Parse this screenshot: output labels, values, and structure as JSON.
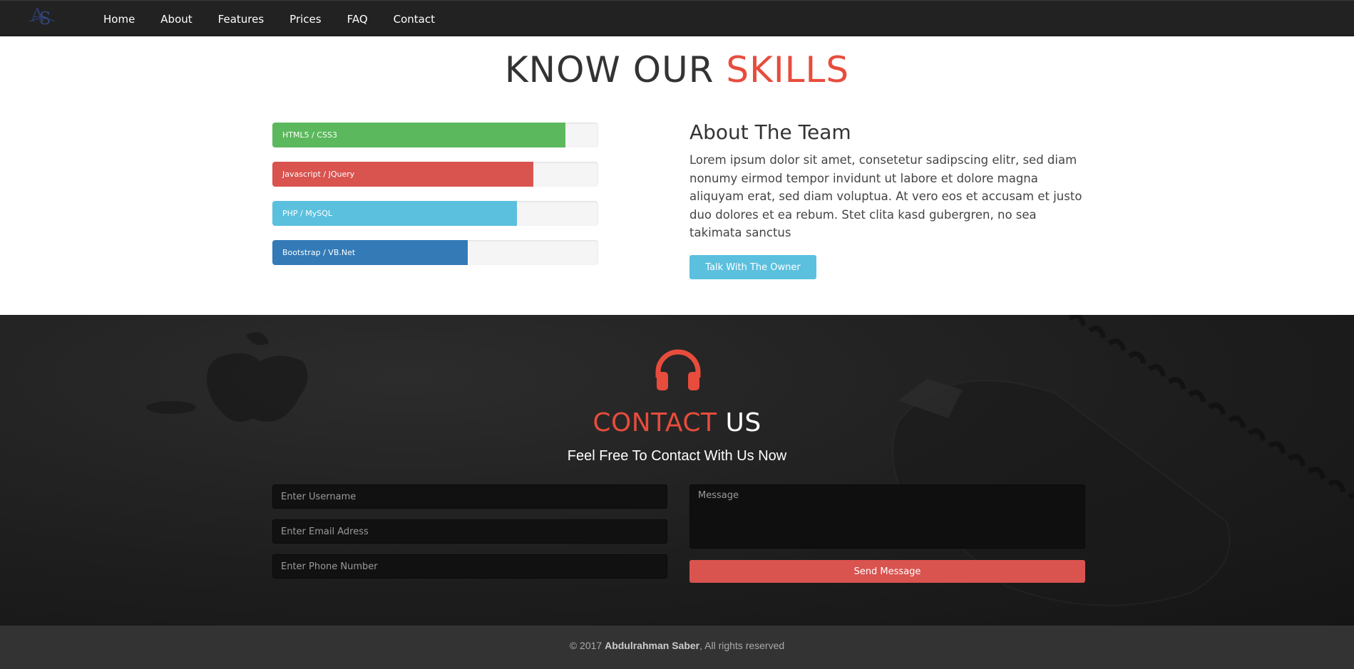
{
  "nav": {
    "items": [
      {
        "label": "Home"
      },
      {
        "label": "About"
      },
      {
        "label": "Features"
      },
      {
        "label": "Prices"
      },
      {
        "label": "FAQ"
      },
      {
        "label": "Contact"
      }
    ]
  },
  "skills": {
    "title_main": "KNOW OUR ",
    "title_accent": "SKILLS",
    "bars": [
      {
        "label": "HTML5 / CSS3",
        "percent": 90,
        "color": "#5cb85c"
      },
      {
        "label": "Javascript / JQuery",
        "percent": 80,
        "color": "#d9534f"
      },
      {
        "label": "PHP / MySQL",
        "percent": 75,
        "color": "#5bc0de"
      },
      {
        "label": "Bootstrap / VB.Net",
        "percent": 60,
        "color": "#337ab7"
      }
    ]
  },
  "team": {
    "title": "About The Team",
    "text": "Lorem ipsum dolor sit amet, consetetur sadipscing elitr, sed diam nonumy eirmod tempor invidunt ut labore et dolore magna aliquyam erat, sed diam voluptua. At vero eos et accusam et justo duo dolores et ea rebum. Stet clita kasd gubergren, no sea takimata sanctus",
    "button_label": "Talk With The Owner"
  },
  "contact": {
    "title_accent": "CONTACT",
    "title_main": " US",
    "subtitle": "Feel Free To Contact With Us Now",
    "username_placeholder": "Enter Username",
    "email_placeholder": "Enter Email Adress",
    "phone_placeholder": "Enter Phone Number",
    "message_placeholder": "Message",
    "send_label": "Send Message"
  },
  "footer": {
    "prefix": "© 2017 ",
    "author": "Abdulrahman Saber",
    "suffix": ", All rights reserved"
  },
  "colors": {
    "accent": "#e74c3c",
    "navbar": "#222222",
    "footer": "#333333"
  }
}
